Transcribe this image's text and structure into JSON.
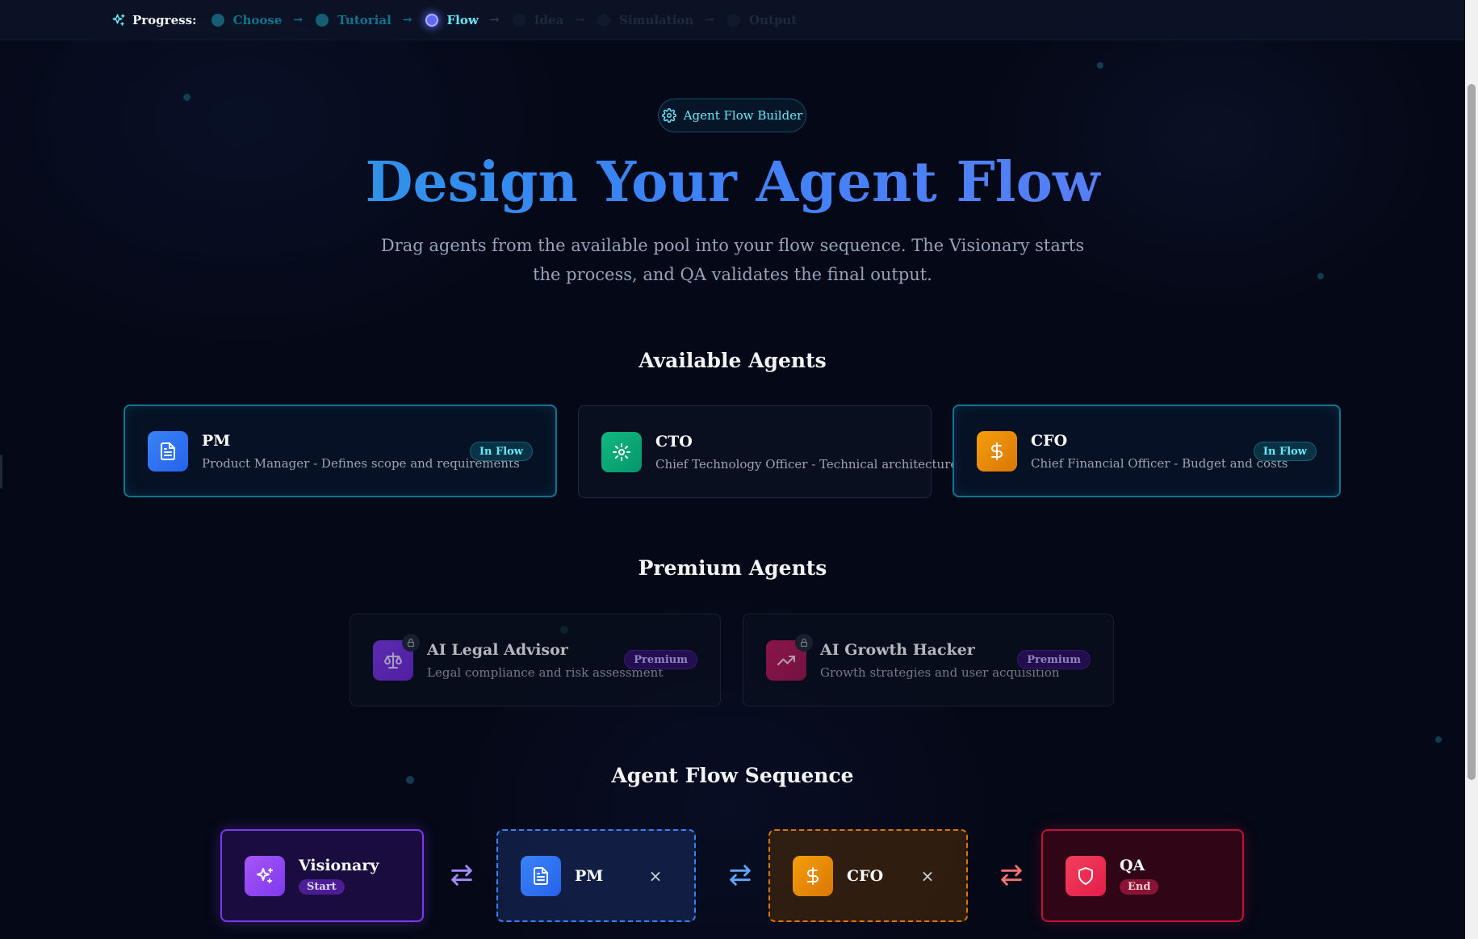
{
  "progress": {
    "label": "Progress:",
    "steps": [
      {
        "name": "Choose",
        "state": "done"
      },
      {
        "name": "Tutorial",
        "state": "done"
      },
      {
        "name": "Flow",
        "state": "active"
      },
      {
        "name": "Idea",
        "state": "todo"
      },
      {
        "name": "Simulation",
        "state": "todo"
      },
      {
        "name": "Output",
        "state": "todo"
      }
    ]
  },
  "header": {
    "badge": "Agent Flow Builder",
    "title": "Design Your Agent Flow",
    "subtitle": "Drag agents from the available pool into your flow sequence. The Visionary starts the process, and QA validates the final output."
  },
  "available": {
    "title": "Available Agents",
    "agents": [
      {
        "name": "PM",
        "desc": "Product Manager - Defines scope and requirements",
        "status": "In Flow",
        "color": "#3b82f6",
        "icon": "document-icon"
      },
      {
        "name": "CTO",
        "desc": "Chief Technology Officer - Technical architecture",
        "status": "",
        "color": "#10b981",
        "icon": "gear-icon"
      },
      {
        "name": "CFO",
        "desc": "Chief Financial Officer - Budget and costs",
        "status": "In Flow",
        "color": "#f59e0b",
        "icon": "dollar-icon"
      }
    ]
  },
  "premium": {
    "title": "Premium Agents",
    "agents": [
      {
        "name": "AI Legal Advisor",
        "desc": "Legal compliance and risk assessment",
        "status": "Premium",
        "color": "#7c3aed",
        "icon": "scale-icon"
      },
      {
        "name": "AI Growth Hacker",
        "desc": "Growth strategies and user acquisition",
        "status": "Premium",
        "color": "#be185d",
        "icon": "trending-up-icon"
      }
    ]
  },
  "flow": {
    "title": "Agent Flow Sequence",
    "nodes": [
      {
        "name": "Visionary",
        "tag": "Start",
        "color": "#8b5cf6",
        "icon": "sparkles-icon"
      },
      {
        "name": "PM",
        "tag": "",
        "remove": "×",
        "color": "#3b82f6",
        "icon": "document-icon"
      },
      {
        "name": "CFO",
        "tag": "",
        "remove": "×",
        "color": "#f59e0b",
        "icon": "dollar-icon"
      },
      {
        "name": "QA",
        "tag": "End",
        "color": "#f43f5e",
        "icon": "shield-icon"
      }
    ]
  }
}
